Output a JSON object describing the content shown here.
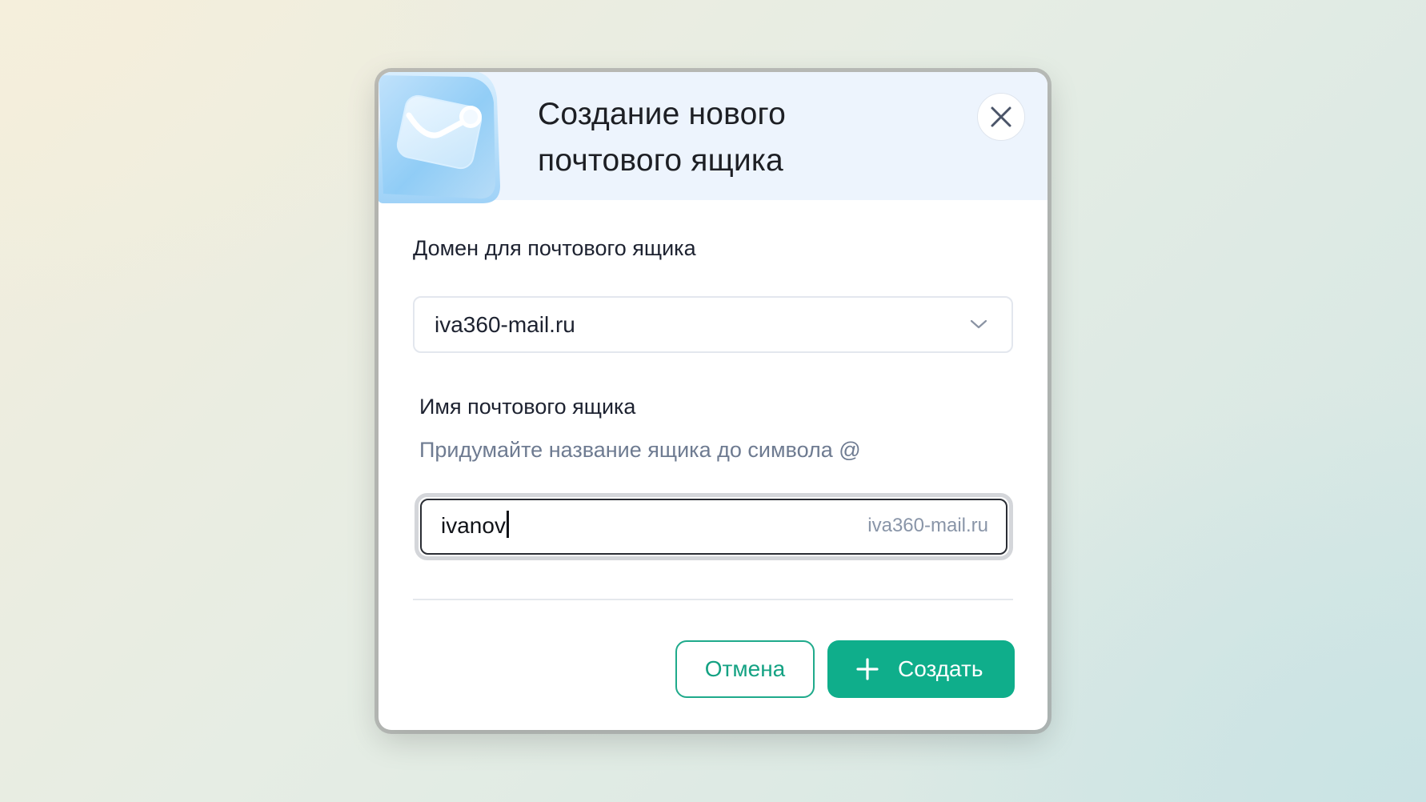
{
  "dialog": {
    "title_line1": "Создание нового",
    "title_line2": "почтового ящика",
    "illustration": "mail-envelope-illustration",
    "close_icon": "close-icon"
  },
  "domain_field": {
    "label": "Домен для почтового ящика",
    "selected_value": "iva360-mail.ru",
    "icon": "chevron-down-icon"
  },
  "mailbox_field": {
    "label": "Имя почтового ящика",
    "hint": "Придумайте название ящика до символа @",
    "value": "ivanov",
    "domain_suffix": "iva360-mail.ru"
  },
  "actions": {
    "cancel_label": "Отмена",
    "create_label": "Создать",
    "create_icon": "plus-icon"
  },
  "colors": {
    "accent": "#0fae8b",
    "header_bg": "#edf4fd",
    "text_primary": "#1d2230",
    "text_muted": "#6e7b91"
  }
}
